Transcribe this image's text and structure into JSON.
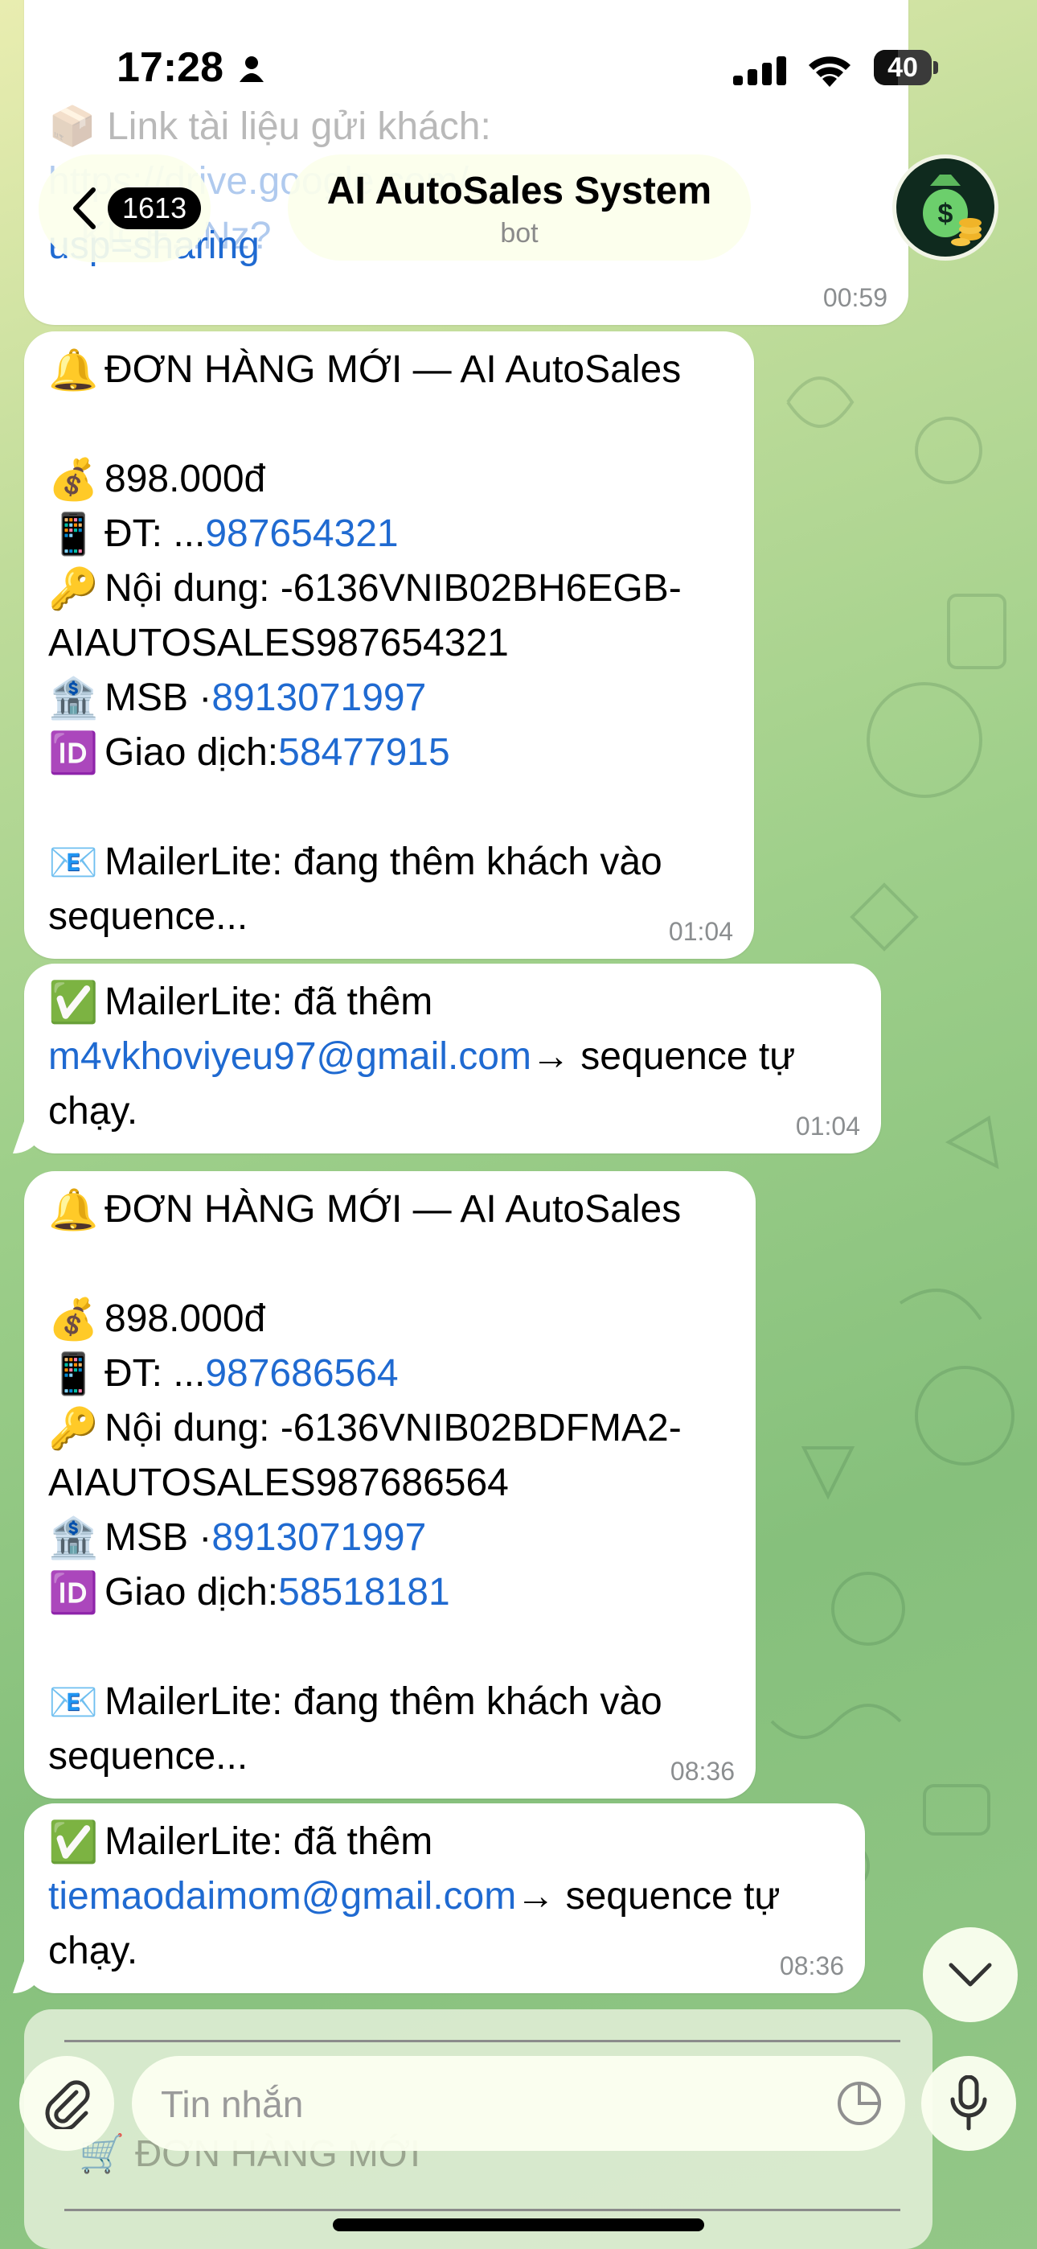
{
  "status_bar": {
    "time": "17:28",
    "battery": "40"
  },
  "header": {
    "unread_count": "1613",
    "title": "AI AutoSales System",
    "subtitle": "bot"
  },
  "messages": [
    {
      "id": "m0",
      "link": "usp=sharing",
      "time": "00:59",
      "behind_text": [
        "📦 Link tài liệu gửi khách:",
        "https://drive.google.com/",
        "...KICE...Nz?"
      ]
    },
    {
      "id": "m1",
      "time": "01:04",
      "title": "ĐƠN HÀNG MỚI — AI AutoSales",
      "amount": "898.000đ",
      "phone_label": "ĐT: ...",
      "phone": "987654321",
      "content_label": "Nội dung: -6136VNIB02BH6EGB-",
      "content_cont": "AIAUTOSALES987654321",
      "bank_label": "MSB · ",
      "bank_account": "8913071997",
      "txn_label": "Giao dịch: ",
      "txn_id": "58477915",
      "mailer_line1": "MailerLite: đang thêm khách vào",
      "mailer_line2": "sequence..."
    },
    {
      "id": "m2",
      "time": "01:04",
      "line1": "MailerLite: đã thêm",
      "email": "m4vkhoviyeu97@gmail.com",
      "after_email": " → sequence tự",
      "line3": "chạy."
    },
    {
      "id": "m3",
      "time": "08:36",
      "title": "ĐƠN HÀNG MỚI — AI AutoSales",
      "amount": "898.000đ",
      "phone_label": "ĐT: ...",
      "phone": "987686564",
      "content_label": "Nội dung: -6136VNIB02BDFMA2-",
      "content_cont": "AIAUTOSALES987686564",
      "bank_label": "MSB · ",
      "bank_account": "8913071997",
      "txn_label": "Giao dịch: ",
      "txn_id": "58518181",
      "mailer_line1": "MailerLite: đang thêm khách vào",
      "mailer_line2": "sequence..."
    },
    {
      "id": "m4",
      "time": "08:36",
      "line1": "MailerLite: đã thêm",
      "email": "tiemaodaimom@gmail.com",
      "after_email": " → sequence tự",
      "line3": "chạy."
    }
  ],
  "pinned_preview": "🛒 ĐƠN HÀNG MỚI",
  "composer": {
    "placeholder": "Tin nhắn"
  },
  "emoji": {
    "bell": "🔔",
    "money": "💰",
    "phone": "📱",
    "key": "🔑",
    "bank": "🏦",
    "id": "🆔",
    "mail": "📧",
    "check": "✅"
  },
  "icons": [
    "person-icon",
    "signal-icon",
    "wifi-icon",
    "battery-icon",
    "chevron-left-icon",
    "money-bag-icon",
    "chevron-down-icon",
    "paperclip-icon",
    "sticker-icon",
    "microphone-icon"
  ],
  "colors": {
    "link": "#1f6ad1",
    "bubble": "#ffffff",
    "time": "#8b8e90"
  }
}
